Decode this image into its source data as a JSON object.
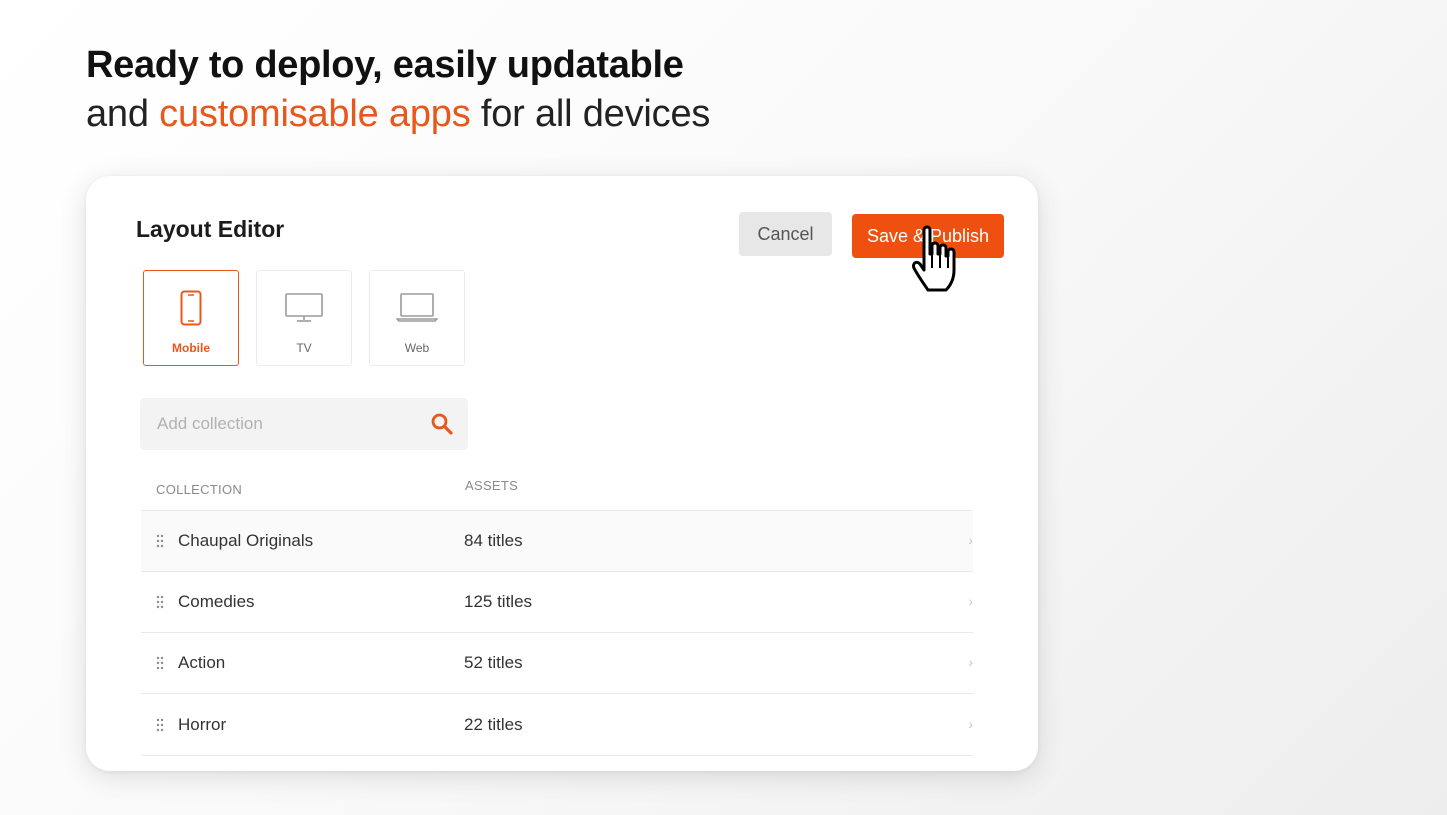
{
  "headline": {
    "line1": "Ready to deploy, easily updatable",
    "line2_prefix": "and ",
    "line2_accent": "customisable apps",
    "line2_suffix": " for all devices"
  },
  "editor": {
    "title": "Layout Editor",
    "cancel_label": "Cancel",
    "save_label": "Save & Publish",
    "device_tabs": [
      {
        "label": "Mobile",
        "icon": "mobile-phone-icon",
        "active": true
      },
      {
        "label": "TV",
        "icon": "tv-icon",
        "active": false
      },
      {
        "label": "Web",
        "icon": "laptop-icon",
        "active": false
      }
    ],
    "search": {
      "placeholder": "Add collection",
      "icon": "search-icon"
    },
    "columns": {
      "collection": "COLLECTION",
      "assets": "ASSETS"
    },
    "rows": [
      {
        "name": "Chaupal Originals",
        "assets": "84 titles"
      },
      {
        "name": "Comedies",
        "assets": "125 titles"
      },
      {
        "name": "Action",
        "assets": "52 titles"
      },
      {
        "name": "Horror",
        "assets": "22 titles"
      }
    ],
    "chevron": "›"
  },
  "colors": {
    "accent": "#e8571c",
    "button": "#f0500f",
    "cancel_bg": "#e7e7e7"
  }
}
